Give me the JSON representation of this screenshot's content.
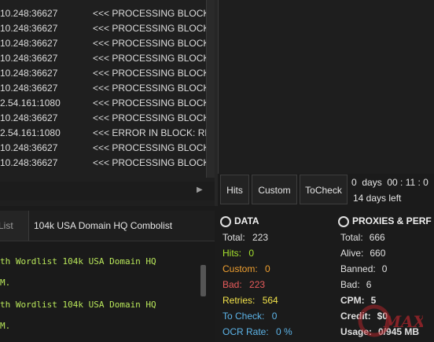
{
  "log": {
    "rows": [
      {
        "addr": "10.248:36627",
        "msg": "<<< PROCESSING BLOCK: RE"
      },
      {
        "addr": "10.248:36627",
        "msg": "<<< PROCESSING BLOCK: RE"
      },
      {
        "addr": "10.248:36627",
        "msg": "<<< PROCESSING BLOCK: RE"
      },
      {
        "addr": "10.248:36627",
        "msg": "<<< PROCESSING BLOCK: RE"
      },
      {
        "addr": "10.248:36627",
        "msg": "<<< PROCESSING BLOCK: RE"
      },
      {
        "addr": "10.248:36627",
        "msg": "<<< PROCESSING BLOCK: RE"
      },
      {
        "addr": "2.54.161:1080",
        "msg": "<<< PROCESSING BLOCK: RE"
      },
      {
        "addr": "10.248:36627",
        "msg": "<<< PROCESSING BLOCK: RE"
      },
      {
        "addr": "2.54.161:1080",
        "msg": "<<< ERROR IN BLOCK: REQU"
      },
      {
        "addr": "10.248:36627",
        "msg": "<<< PROCESSING BLOCK: RE"
      },
      {
        "addr": "10.248:36627",
        "msg": "<<< PROCESSING BLOCK: RE"
      }
    ],
    "scroll_arrow": "▶"
  },
  "buttons": {
    "hits": "Hits",
    "custom": "Custom",
    "tocheck": "ToCheck"
  },
  "timer": {
    "elapsed": "0  days  00 : 11 : 0",
    "remaining": "14 days left"
  },
  "tabs": {
    "inactive": "Hit List",
    "active": "104k USA Domain HQ Combolist"
  },
  "wordlist": {
    "lines": [
      "th Wordlist 104k USA Domain HQ",
      "M.",
      "th Wordlist 104k USA Domain HQ",
      "M."
    ]
  },
  "data_panel": {
    "title": "DATA",
    "stats": [
      {
        "label": "Total:",
        "value": "223",
        "color": "#e0e0e0"
      },
      {
        "label": "Hits:",
        "value": "0",
        "color": "#a6e22e"
      },
      {
        "label": "Custom:",
        "value": "0",
        "color": "#f0a030"
      },
      {
        "label": "Bad:",
        "value": "223",
        "color": "#e85c5c"
      },
      {
        "label": "Retries:",
        "value": "564",
        "color": "#f2e24a"
      },
      {
        "label": "To Check:",
        "value": "0",
        "color": "#5db4e8"
      },
      {
        "label": "OCR Rate:",
        "value": "0 %",
        "color": "#5db4e8"
      }
    ]
  },
  "proxies_panel": {
    "title": "PROXIES & PERF",
    "stats": [
      {
        "label": "Total:",
        "value": "666"
      },
      {
        "label": "Alive:",
        "value": "660"
      },
      {
        "label": "Banned:",
        "value": "0"
      },
      {
        "label": "Bad:",
        "value": "6"
      },
      {
        "label": "CPM:",
        "value": "5"
      },
      {
        "label": "Credit:",
        "value": "$0"
      },
      {
        "label": "Usage:",
        "value": "0/945 MB"
      }
    ]
  },
  "watermark": "MAX"
}
